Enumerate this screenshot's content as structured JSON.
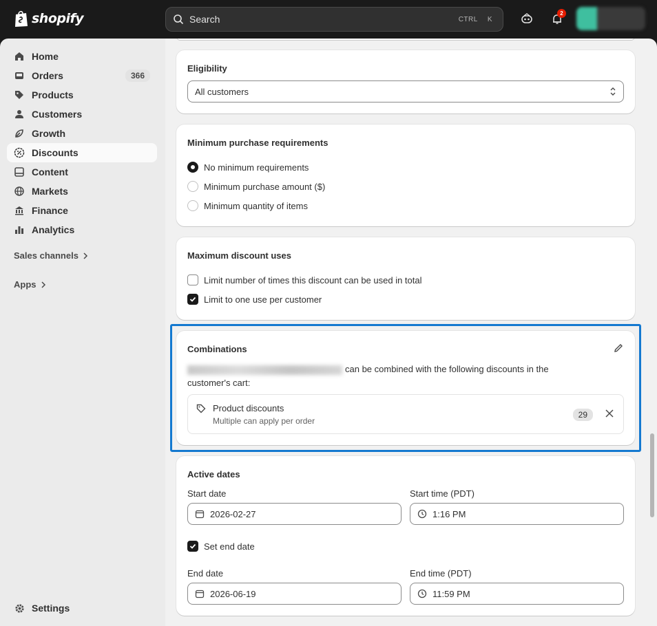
{
  "brand": {
    "name": "shopify"
  },
  "search": {
    "placeholder": "Search",
    "shortcut_1": "CTRL",
    "shortcut_2": "K"
  },
  "notifications": {
    "count": "2"
  },
  "sidebar": {
    "items": [
      {
        "label": "Home",
        "icon": "home-icon"
      },
      {
        "label": "Orders",
        "icon": "inbox-icon",
        "count": "366"
      },
      {
        "label": "Products",
        "icon": "tag-icon"
      },
      {
        "label": "Customers",
        "icon": "person-icon"
      },
      {
        "label": "Growth",
        "icon": "growth-icon"
      },
      {
        "label": "Discounts",
        "icon": "discount-icon",
        "active": true
      },
      {
        "label": "Content",
        "icon": "content-icon"
      },
      {
        "label": "Markets",
        "icon": "globe-icon"
      },
      {
        "label": "Finance",
        "icon": "bank-icon"
      },
      {
        "label": "Analytics",
        "icon": "bar-chart-icon"
      }
    ],
    "sales_channels": "Sales channels",
    "apps": "Apps",
    "settings": "Settings"
  },
  "eligibility": {
    "title": "Eligibility",
    "value": "All customers"
  },
  "minimum": {
    "title": "Minimum purchase requirements",
    "options": [
      "No minimum requirements",
      "Minimum purchase amount ($)",
      "Minimum quantity of items"
    ],
    "selected": 0
  },
  "max_uses": {
    "title": "Maximum discount uses",
    "options": [
      {
        "label": "Limit number of times this discount can be used in total",
        "checked": false
      },
      {
        "label": "Limit to one use per customer",
        "checked": true
      }
    ]
  },
  "combinations": {
    "title": "Combinations",
    "text_after": "can be combined with the following discounts in the",
    "text_line2": "customer's cart:",
    "item_title": "Product discounts",
    "item_sub": "Multiple can apply per order",
    "item_count": "29"
  },
  "active_dates": {
    "title": "Active dates",
    "start_date_label": "Start date",
    "start_date": "2026-02-27",
    "start_time_label": "Start time (PDT)",
    "start_time": "1:16 PM",
    "set_end_label": "Set end date",
    "set_end_checked": true,
    "end_date_label": "End date",
    "end_date": "2026-06-19",
    "end_time_label": "End time (PDT)",
    "end_time": "11:59 PM"
  },
  "colors": {
    "highlight": "#1479d0",
    "sidebar_bg": "#ebebeb",
    "topbar_bg": "#1a1a1a"
  }
}
